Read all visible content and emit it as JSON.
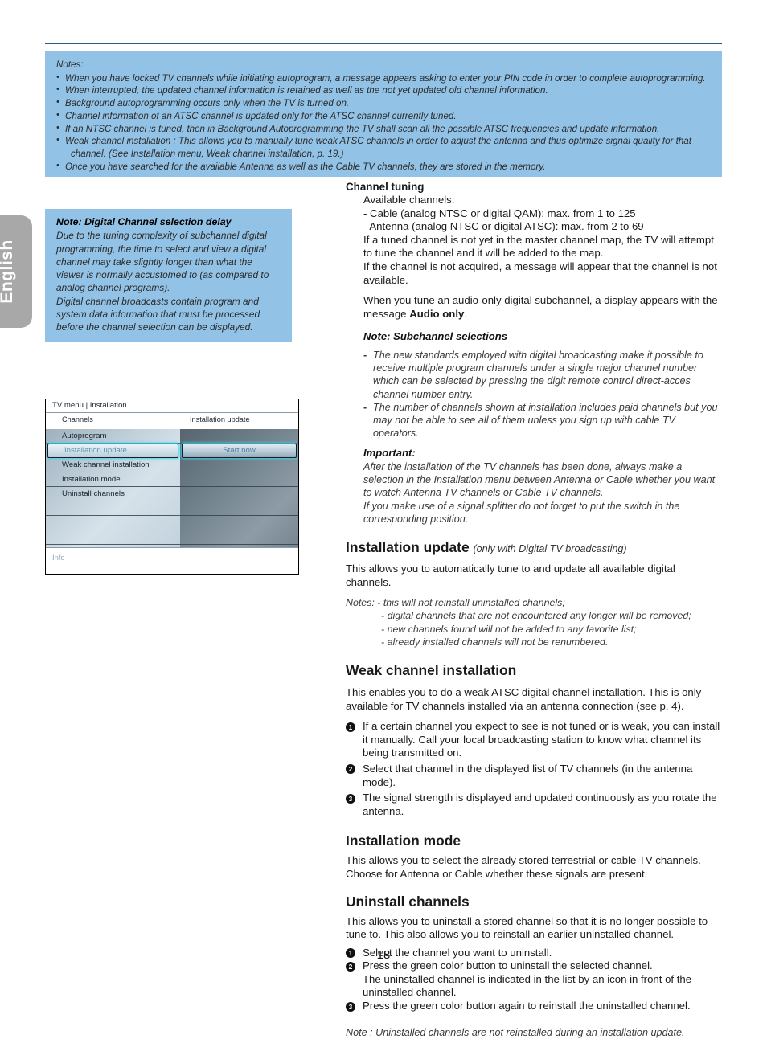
{
  "language_tab": {
    "label": "English"
  },
  "page": {
    "number": "18"
  },
  "notes_banner": {
    "title": "Notes:",
    "items": [
      "When you have locked TV channels while initiating autoprogram, a message appears asking to enter your PIN code in order to complete autoprogramming.",
      "When interrupted, the updated channel information is retained as well as the not yet updated old channel information.",
      "Background autoprogramming occurs only when the TV is turned on.",
      "Channel information of an ATSC channel is updated only for the ATSC channel currently tuned.",
      "If an NTSC channel is tuned, then in Background Autoprogramming the TV shall scan all the possible ATSC frequencies and update information.",
      "Weak channel installation : This allows you to manually tune weak ATSC channels in order to adjust the antenna and thus optimize signal quality for that",
      "Once you have searched for the available Antenna as well as the Cable TV channels, they are stored in the memory."
    ],
    "item6_continuation": "channel. (See Installation menu, Weak channel installation, p. 19.)"
  },
  "digital_note": {
    "title": "Note: Digital Channel selection delay",
    "paragraph1": "Due to the tuning complexity of subchannel digital programming, the time to select and view a digital channel may take slightly longer than what the viewer is normally accustomed to (as compared to analog channel programs).",
    "paragraph2": "Digital channel broadcasts contain program and system data information that must be processed before the channel selection can be displayed."
  },
  "tv_menu": {
    "title": "TV menu | Installation",
    "column_headers": {
      "left": "Channels",
      "right": "Installation update"
    },
    "left_items": [
      {
        "label": "Autoprogram",
        "selected": false
      },
      {
        "label": "Installation update",
        "selected": true
      },
      {
        "label": "Weak channel installation",
        "selected": false
      },
      {
        "label": "Installation mode",
        "selected": false
      },
      {
        "label": "Uninstall  channels",
        "selected": false
      },
      {
        "label": "",
        "selected": false
      },
      {
        "label": "",
        "selected": false
      },
      {
        "label": "",
        "selected": false
      }
    ],
    "right_items": [
      {
        "label": "",
        "selected": false
      },
      {
        "label": "Start now",
        "selected": true
      },
      {
        "label": "",
        "selected": false
      },
      {
        "label": "",
        "selected": false
      },
      {
        "label": "",
        "selected": false
      },
      {
        "label": "",
        "selected": false
      },
      {
        "label": "",
        "selected": false
      },
      {
        "label": "",
        "selected": false
      }
    ],
    "info_label": "Info"
  },
  "channel_tuning": {
    "heading": "Channel tuning",
    "available_label": "Available channels:",
    "cable_line": "- Cable (analog NTSC or digital QAM): max. from 1 to 125",
    "antenna_line": "- Antenna (analog NTSC or digital ATSC): max. from 2 to 69",
    "para1": "If a tuned channel is not yet in the master channel map, the TV will attempt to tune the channel and it will be added to the map.",
    "para2": "If the channel is not acquired, a message will appear that the channel is not available.",
    "para3_pre": "When you tune an audio-only digital subchannel, a display appears with the message ",
    "para3_bold": "Audio only",
    "para3_post": ".",
    "subchannel_note": {
      "heading": "Note: Subchannel selections",
      "items": [
        "The new standards employed with digital broadcasting make it possible to receive multiple program channels under a single major channel number which can be selected by pressing the digit remote control direct-acces channel number entry.",
        "The number of channels shown at installation includes paid channels but you may not be able to see all of them unless you sign up with cable TV operators."
      ]
    },
    "important": {
      "heading": "Important:",
      "para1": "After the installation of the TV channels has been done, always make a selection in the Installation menu between Antenna or Cable whether you want to watch Antenna TV channels or Cable TV channels.",
      "para2": "If you make use of a signal splitter do not forget to put the switch in the corresponding position."
    }
  },
  "installation_update": {
    "heading": "Installation update",
    "heading_sub": "(only with Digital TV broadcasting)",
    "body": "This allows you to automatically tune to and update all available digital channels.",
    "notes_label": "Notes:",
    "notes": [
      "- this will not reinstall uninstalled channels;",
      "- digital channels that are not encountered any longer will be removed;",
      "- new channels found will not be added to any favorite list;",
      "- already installed channels will not be renumbered."
    ]
  },
  "weak_channel_installation": {
    "heading": "Weak channel installation",
    "body": "This enables you to do a weak ATSC digital channel installation. This is only available for TV channels installed via an antenna connection (see p. 4).",
    "steps": [
      "If a certain channel you expect to see is not tuned or is weak, you can install it manually. Call your local broadcasting station to know what channel its being transmitted on.",
      "Select that channel in the displayed list of TV channels (in the antenna mode).",
      "The signal strength is displayed and updated continuously as you rotate the antenna."
    ]
  },
  "installation_mode": {
    "heading": "Installation mode",
    "body": "This allows you to select the already stored terrestrial or cable TV channels. Choose for Antenna or Cable whether these signals are present."
  },
  "uninstall_channels": {
    "heading": "Uninstall channels",
    "body": "This allows you to uninstall a stored channel so that it is no longer possible to tune to. This also allows you to reinstall an earlier uninstalled channel.",
    "steps": [
      "Select the channel you want to uninstall.",
      "Press the green color button to uninstall the selected channel.",
      "Press the green color button again to reinstall the uninstalled channel."
    ],
    "step2_continuation": "The uninstalled channel is indicated in the list by an icon in front of the uninstalled channel.",
    "footer_note": "Note : Uninstalled channels are not reinstalled during an installation update."
  },
  "colors": {
    "banner_blue": "#92c2e6",
    "rule_blue": "#1f5d8c",
    "tab_grey": "#a8a8a8"
  }
}
